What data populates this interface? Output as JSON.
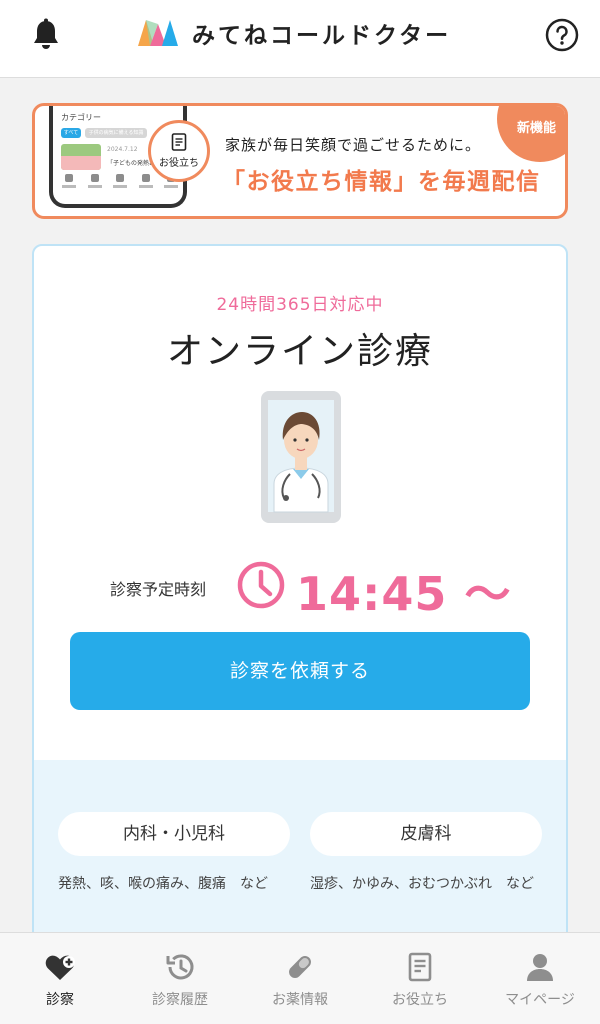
{
  "app": {
    "title": "みてねコールドクター"
  },
  "header": {
    "bell_icon": "bell-icon",
    "help_icon": "question-circle-icon"
  },
  "banner": {
    "phone_category": "カテゴリー",
    "phone_chip_all": "すべて",
    "phone_chip_other": "子供の病気に備える知識",
    "phone_date": "2024.7.12",
    "phone_article": "「子どもの発熱おさ",
    "useful_badge_label": "お役立ち",
    "line_a": "家族が毎日笑顔で過ごせるために。",
    "line_b": "「お役立ち情報」を毎週配信",
    "new_badge": "新機能",
    "accent_color": "#f08a5d"
  },
  "main": {
    "subtitle": "24時間365日対応中",
    "title": "オンライン診療",
    "schedule_label": "診察予定時刻",
    "schedule_time": "14:45 〜",
    "cta_label": "診察を依頼する",
    "departments": [
      {
        "name": "内科・小児科",
        "description": "発熱、咳、喉の痛み、腹痛　など"
      },
      {
        "name": "皮膚科",
        "description": "湿疹、かゆみ、おむつかぶれ　など"
      }
    ]
  },
  "tabbar": {
    "items": [
      {
        "label": "診察",
        "icon": "heart-plus-icon",
        "active": true
      },
      {
        "label": "診察履歴",
        "icon": "history-icon",
        "active": false
      },
      {
        "label": "お薬情報",
        "icon": "pill-icon",
        "active": false
      },
      {
        "label": "お役立ち",
        "icon": "document-icon",
        "active": false
      },
      {
        "label": "マイページ",
        "icon": "person-icon",
        "active": false
      }
    ]
  },
  "colors": {
    "pink": "#ef6b9a",
    "blue": "#26abe9",
    "orange": "#f27a4d"
  }
}
